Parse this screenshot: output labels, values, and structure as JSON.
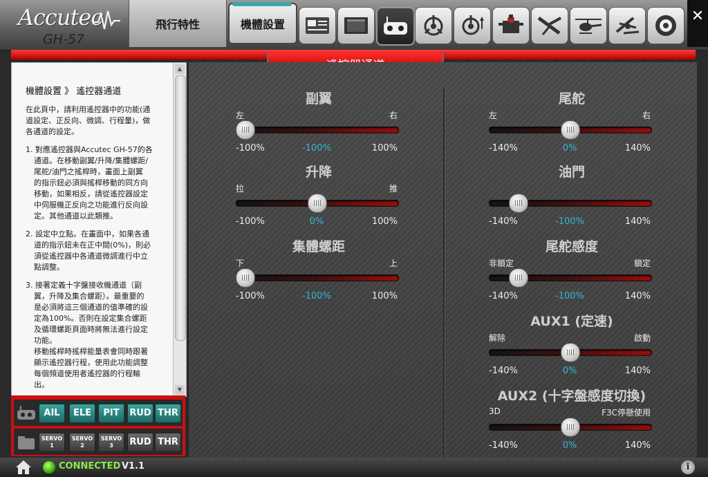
{
  "app": {
    "brand": "Accutec",
    "model": "GH-57"
  },
  "tabs": {
    "flight": "飛行特性",
    "setup": "機體設置"
  },
  "toolbar_icons": [
    "monitor-card-icon",
    "screen-icon",
    "transmitter-icon",
    "swashplate-icon",
    "swash-limit-icon",
    "servo-icon",
    "tail-rotor-icon",
    "helicopter-icon",
    "gyro-heli-icon",
    "disc-icon"
  ],
  "page": {
    "title": "遙控器通道"
  },
  "help": {
    "title": "機體設置 》 遙控器通道",
    "intro_lines": [
      "在此頁中，請利用遙控器中的功能(通",
      "道設定、正反向、微調、行程量)，做",
      "各通道的設定。"
    ],
    "item1_lines": [
      "1. 對應遙控器與Accutec GH-57的各",
      "通道。在移動副翼/升降/集體螺距/",
      "尾舵/油門之搖桿時，畫面上副翼",
      "的指示鈕必須與搖桿移動的同方向",
      "移動，如果相反，請從遙控器設定",
      "中伺服機正反向之功能進行反向設",
      "定。其他通道以此類推。"
    ],
    "item2_lines": [
      "2. 設定中立點。在畫面中，如果各通",
      "道的指示鈕未在正中間(0%)，則必",
      "須從遙控器中各通道微調進行中立",
      "點調整。"
    ],
    "item3_lines": [
      "3. 接著定義十字盤接收機通道（副",
      "翼，升降及集合螺距）。最重要的",
      "是必須將這三個通道的值準確的設",
      "定為100%。否則在設定集合螺距",
      "及循環螺距頁面時將無法進行設定",
      "功能。",
      "移動搖桿時搖桿能量表會同時跟著",
      "顯示遙控器行程，使用此功能調整",
      "每個頻道使用者遙控器的行程輸",
      "出。"
    ]
  },
  "channel_panel": {
    "row1": [
      "AIL",
      "ELE",
      "PIT",
      "RUD",
      "THR"
    ],
    "row2": [
      {
        "top": "SERVO",
        "bottom": "1"
      },
      {
        "top": "SERVO",
        "bottom": "2"
      },
      {
        "top": "SERVO",
        "bottom": "3"
      },
      {
        "top": "RUD",
        "bottom": ""
      },
      {
        "top": "THR",
        "bottom": ""
      }
    ]
  },
  "controls": {
    "aileron": {
      "title": "副翼",
      "left_label": "左",
      "right_label": "右",
      "min": "-100%",
      "value": "-100%",
      "max": "100%",
      "position": 0.0
    },
    "elevator": {
      "title": "升降",
      "left_label": "拉",
      "right_label": "推",
      "min": "-100%",
      "value": "0%",
      "max": "100%",
      "position": 0.5
    },
    "collective": {
      "title": "集體螺距",
      "left_label": "下",
      "right_label": "上",
      "min": "-100%",
      "value": "-100%",
      "max": "100%",
      "position": 0.0
    },
    "rudder": {
      "title": "尾舵",
      "left_label": "左",
      "right_label": "右",
      "min": "-140%",
      "value": "0%",
      "max": "140%",
      "position": 0.5
    },
    "throttle": {
      "title": "油門",
      "left_label": "",
      "right_label": "",
      "min": "-140%",
      "value": "-100%",
      "max": "140%",
      "position": 0.14
    },
    "gyro_gain": {
      "title": "尾舵感度",
      "left_label": "非鎖定",
      "right_label": "鎖定",
      "min": "-140%",
      "value": "-100%",
      "max": "140%",
      "position": 0.14
    },
    "aux1": {
      "title": "AUX1 (定速)",
      "left_label": "解除",
      "right_label": "啟動",
      "min": "-140%",
      "value": "0%",
      "max": "140%",
      "position": 0.5
    },
    "aux2": {
      "title": "AUX2 (十字盤感度切換)",
      "left_label": "3D",
      "right_label": "F3C停懸使用",
      "min": "-140%",
      "value": "0%",
      "max": "140%",
      "position": 0.5
    }
  },
  "status": {
    "connection": "CONNECTED",
    "version": "V1.1"
  }
}
